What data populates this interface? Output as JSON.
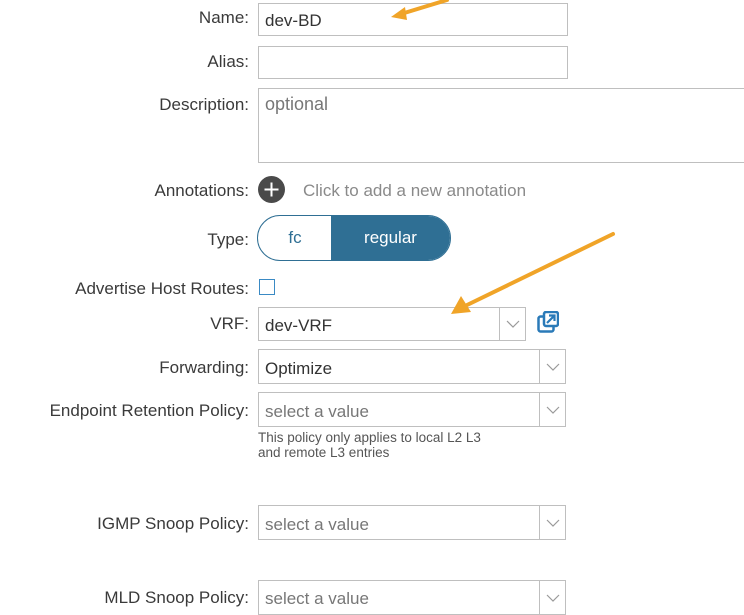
{
  "fields": {
    "name": {
      "label": "Name:",
      "value": "dev-BD"
    },
    "alias": {
      "label": "Alias:",
      "value": ""
    },
    "description": {
      "label": "Description:",
      "placeholder": "optional"
    },
    "annotations": {
      "label": "Annotations:",
      "hint": "Click to add a new annotation"
    },
    "type": {
      "label": "Type:",
      "options": [
        "fc",
        "regular"
      ],
      "selected": "regular"
    },
    "advertise_host_routes": {
      "label": "Advertise Host Routes:",
      "checked": false
    },
    "vrf": {
      "label": "VRF:",
      "value": "dev-VRF"
    },
    "forwarding": {
      "label": "Forwarding:",
      "value": "Optimize"
    },
    "endpoint_retention_policy": {
      "label": "Endpoint Retention Policy:",
      "placeholder": "select a value",
      "note_line1": "This policy only applies to local L2 L3",
      "note_line2": "and remote L3 entries"
    },
    "igmp_snoop_policy": {
      "label": "IGMP Snoop Policy:",
      "placeholder": "select a value"
    },
    "mld_snoop_policy": {
      "label": "MLD Snoop Policy:",
      "placeholder": "select a value"
    }
  },
  "colors": {
    "accent": "#2f6f94",
    "link_icon": "#2a7ab8",
    "annotation_arrow": "#f0a428",
    "plus_button": "#4a4a4a"
  },
  "icons": {
    "annotation_add": "plus-circle-icon",
    "vrf_open": "external-link-icon",
    "dropdown": "chevron-down-icon"
  }
}
